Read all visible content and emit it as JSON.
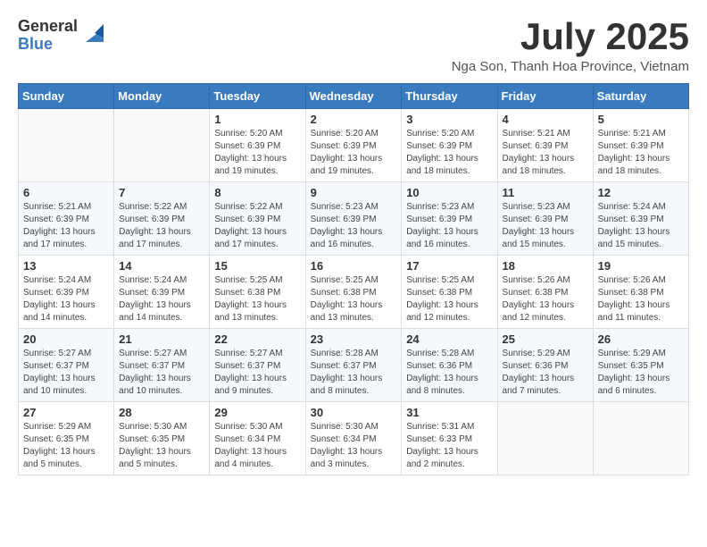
{
  "logo": {
    "general": "General",
    "blue": "Blue"
  },
  "title": "July 2025",
  "location": "Nga Son, Thanh Hoa Province, Vietnam",
  "days_of_week": [
    "Sunday",
    "Monday",
    "Tuesday",
    "Wednesday",
    "Thursday",
    "Friday",
    "Saturday"
  ],
  "weeks": [
    [
      {
        "day": "",
        "info": ""
      },
      {
        "day": "",
        "info": ""
      },
      {
        "day": "1",
        "info": "Sunrise: 5:20 AM\nSunset: 6:39 PM\nDaylight: 13 hours and 19 minutes."
      },
      {
        "day": "2",
        "info": "Sunrise: 5:20 AM\nSunset: 6:39 PM\nDaylight: 13 hours and 19 minutes."
      },
      {
        "day": "3",
        "info": "Sunrise: 5:20 AM\nSunset: 6:39 PM\nDaylight: 13 hours and 18 minutes."
      },
      {
        "day": "4",
        "info": "Sunrise: 5:21 AM\nSunset: 6:39 PM\nDaylight: 13 hours and 18 minutes."
      },
      {
        "day": "5",
        "info": "Sunrise: 5:21 AM\nSunset: 6:39 PM\nDaylight: 13 hours and 18 minutes."
      }
    ],
    [
      {
        "day": "6",
        "info": "Sunrise: 5:21 AM\nSunset: 6:39 PM\nDaylight: 13 hours and 17 minutes."
      },
      {
        "day": "7",
        "info": "Sunrise: 5:22 AM\nSunset: 6:39 PM\nDaylight: 13 hours and 17 minutes."
      },
      {
        "day": "8",
        "info": "Sunrise: 5:22 AM\nSunset: 6:39 PM\nDaylight: 13 hours and 17 minutes."
      },
      {
        "day": "9",
        "info": "Sunrise: 5:23 AM\nSunset: 6:39 PM\nDaylight: 13 hours and 16 minutes."
      },
      {
        "day": "10",
        "info": "Sunrise: 5:23 AM\nSunset: 6:39 PM\nDaylight: 13 hours and 16 minutes."
      },
      {
        "day": "11",
        "info": "Sunrise: 5:23 AM\nSunset: 6:39 PM\nDaylight: 13 hours and 15 minutes."
      },
      {
        "day": "12",
        "info": "Sunrise: 5:24 AM\nSunset: 6:39 PM\nDaylight: 13 hours and 15 minutes."
      }
    ],
    [
      {
        "day": "13",
        "info": "Sunrise: 5:24 AM\nSunset: 6:39 PM\nDaylight: 13 hours and 14 minutes."
      },
      {
        "day": "14",
        "info": "Sunrise: 5:24 AM\nSunset: 6:39 PM\nDaylight: 13 hours and 14 minutes."
      },
      {
        "day": "15",
        "info": "Sunrise: 5:25 AM\nSunset: 6:38 PM\nDaylight: 13 hours and 13 minutes."
      },
      {
        "day": "16",
        "info": "Sunrise: 5:25 AM\nSunset: 6:38 PM\nDaylight: 13 hours and 13 minutes."
      },
      {
        "day": "17",
        "info": "Sunrise: 5:25 AM\nSunset: 6:38 PM\nDaylight: 13 hours and 12 minutes."
      },
      {
        "day": "18",
        "info": "Sunrise: 5:26 AM\nSunset: 6:38 PM\nDaylight: 13 hours and 12 minutes."
      },
      {
        "day": "19",
        "info": "Sunrise: 5:26 AM\nSunset: 6:38 PM\nDaylight: 13 hours and 11 minutes."
      }
    ],
    [
      {
        "day": "20",
        "info": "Sunrise: 5:27 AM\nSunset: 6:37 PM\nDaylight: 13 hours and 10 minutes."
      },
      {
        "day": "21",
        "info": "Sunrise: 5:27 AM\nSunset: 6:37 PM\nDaylight: 13 hours and 10 minutes."
      },
      {
        "day": "22",
        "info": "Sunrise: 5:27 AM\nSunset: 6:37 PM\nDaylight: 13 hours and 9 minutes."
      },
      {
        "day": "23",
        "info": "Sunrise: 5:28 AM\nSunset: 6:37 PM\nDaylight: 13 hours and 8 minutes."
      },
      {
        "day": "24",
        "info": "Sunrise: 5:28 AM\nSunset: 6:36 PM\nDaylight: 13 hours and 8 minutes."
      },
      {
        "day": "25",
        "info": "Sunrise: 5:29 AM\nSunset: 6:36 PM\nDaylight: 13 hours and 7 minutes."
      },
      {
        "day": "26",
        "info": "Sunrise: 5:29 AM\nSunset: 6:35 PM\nDaylight: 13 hours and 6 minutes."
      }
    ],
    [
      {
        "day": "27",
        "info": "Sunrise: 5:29 AM\nSunset: 6:35 PM\nDaylight: 13 hours and 5 minutes."
      },
      {
        "day": "28",
        "info": "Sunrise: 5:30 AM\nSunset: 6:35 PM\nDaylight: 13 hours and 5 minutes."
      },
      {
        "day": "29",
        "info": "Sunrise: 5:30 AM\nSunset: 6:34 PM\nDaylight: 13 hours and 4 minutes."
      },
      {
        "day": "30",
        "info": "Sunrise: 5:30 AM\nSunset: 6:34 PM\nDaylight: 13 hours and 3 minutes."
      },
      {
        "day": "31",
        "info": "Sunrise: 5:31 AM\nSunset: 6:33 PM\nDaylight: 13 hours and 2 minutes."
      },
      {
        "day": "",
        "info": ""
      },
      {
        "day": "",
        "info": ""
      }
    ]
  ]
}
